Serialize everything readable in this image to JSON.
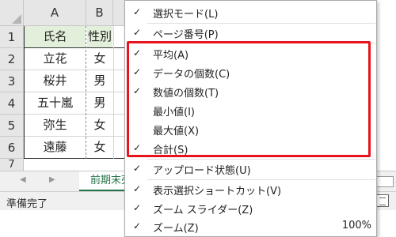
{
  "spreadsheet": {
    "columns": [
      "A",
      "B"
    ],
    "rows": [
      "1",
      "2",
      "3",
      "4",
      "5",
      "6",
      "7"
    ],
    "header_cells": [
      "氏名",
      "性別"
    ],
    "data_rows": [
      [
        "立花",
        "女"
      ],
      [
        "桜井",
        "男"
      ],
      [
        "五十嵐",
        "男"
      ],
      [
        "弥生",
        "女"
      ],
      [
        "遠藤",
        "女"
      ]
    ],
    "header_fill": "#e2efda"
  },
  "tabbar": {
    "sheet_tab_label": "前期末売",
    "prev_glyph": "◀",
    "next_glyph": "▶"
  },
  "statusbar": {
    "status_text": "準備完了"
  },
  "context_menu": {
    "items": [
      {
        "checked": true,
        "label": "選択モード(L)",
        "value": ""
      },
      {
        "checked": true,
        "label": "ページ番号(P)",
        "value": ""
      },
      {
        "checked": true,
        "label": "平均(A)",
        "value": ""
      },
      {
        "checked": true,
        "label": "データの個数(C)",
        "value": ""
      },
      {
        "checked": true,
        "label": "数値の個数(T)",
        "value": ""
      },
      {
        "checked": false,
        "label": "最小値(I)",
        "value": ""
      },
      {
        "checked": false,
        "label": "最大値(X)",
        "value": ""
      },
      {
        "checked": true,
        "label": "合計(S)",
        "value": ""
      },
      {
        "checked": true,
        "label": "アップロード状態(U)",
        "value": ""
      },
      {
        "checked": true,
        "label": "表示選択ショートカット(V)",
        "value": ""
      },
      {
        "checked": true,
        "label": "ズーム スライダー(Z)",
        "value": ""
      },
      {
        "checked": true,
        "label": "ズーム(Z)",
        "value": "100%"
      }
    ],
    "check_glyph": "✓",
    "highlight_color": "#e8131c"
  },
  "colors": {
    "accent": "#217346",
    "header_bg": "#e6e6e6"
  }
}
